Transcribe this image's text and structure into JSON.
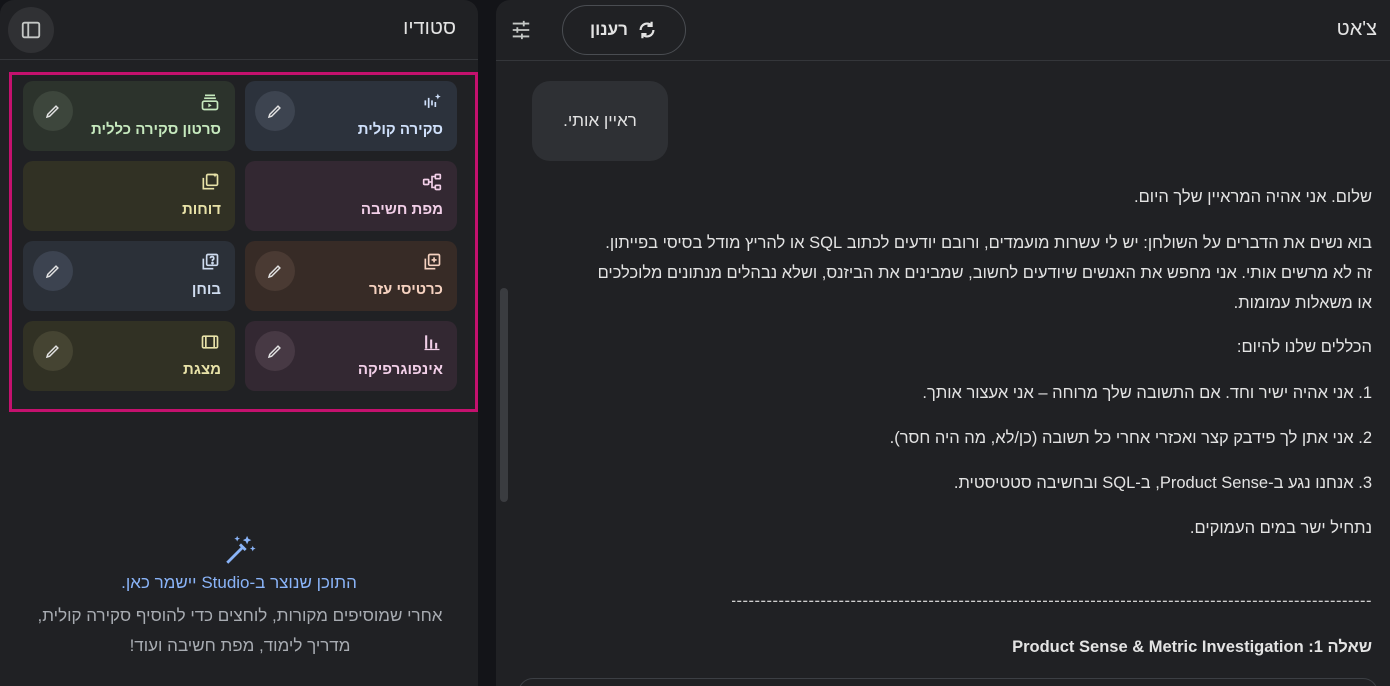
{
  "studio": {
    "title": "סטודיו",
    "tiles": [
      {
        "label": "סקירה קולית",
        "icon": "audio-sparkle-icon"
      },
      {
        "label": "סרטון סקירה כללית",
        "icon": "video-overview-icon"
      },
      {
        "label": "מפת חשיבה",
        "icon": "mind-map-icon"
      },
      {
        "label": "דוחות",
        "icon": "reports-icon"
      },
      {
        "label": "כרטיסי עזר",
        "icon": "flashcards-icon"
      },
      {
        "label": "בוחן",
        "icon": "quiz-icon"
      },
      {
        "label": "אינפוגרפיקה",
        "icon": "infographic-icon"
      },
      {
        "label": "מצגת",
        "icon": "slides-icon"
      }
    ],
    "empty_state": {
      "title": "התוכן שנוצר ב-Studio יישמר כאן.",
      "description": "אחרי שמוסיפים מקורות, לוחצים כדי להוסיף סקירה קולית, מדריך לימוד, מפת חשיבה ועוד!"
    }
  },
  "chat": {
    "title": "צ'אט",
    "refresh_label": "רענון",
    "user_message": "ראיין אותי.",
    "response": {
      "greeting": "שלום. אני אהיה המראיין שלך היום.",
      "intro": "בוא נשים את הדברים על השולחן: יש לי עשרות מועמדים, ורובם יודעים לכתוב SQL או להריץ מודל בסיסי בפייתון. זה לא מרשים אותי. אני מחפש את האנשים שיודעים לחשוב, שמבינים את הביזנס, ושלא נבהלים מנתונים מלוכלכים או משאלות עמומות.",
      "rules_heading": "הכללים שלנו להיום:",
      "rule_1": "1. אני אהיה ישיר וחד. אם התשובה שלך מרוחה – אני אעצור אותך.",
      "rule_2": "2. אני אתן לך פידבק קצר ואכזרי אחרי כל תשובה (כן/לא, מה היה חסר).",
      "rule_3": "3. אנחנו נגע ב-Product Sense, ב-SQL ובחשיבה סטטיסטית.",
      "dive": "נתחיל ישר במים העמוקים.",
      "divider": "----------------------------------------------------------------------------------------------------------------------------------------",
      "question_1": "שאלה 1: Product Sense & Metric Investigation"
    }
  },
  "colors": {
    "highlight_border": "#c4116e",
    "accent_blue": "#8ab4f8"
  }
}
